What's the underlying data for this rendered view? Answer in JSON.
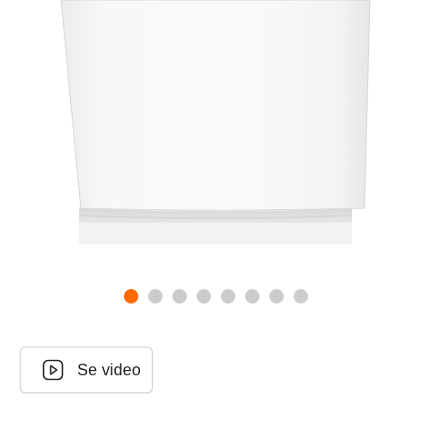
{
  "product_image": {
    "alt": "",
    "panel_color": "#f4f4f4"
  },
  "carousel": {
    "total_slides": 8,
    "active_index": 0,
    "active_color": "#ff6a00",
    "inactive_color": "#cccccc"
  },
  "video_button": {
    "label": "Se video",
    "icon": "play-icon"
  }
}
